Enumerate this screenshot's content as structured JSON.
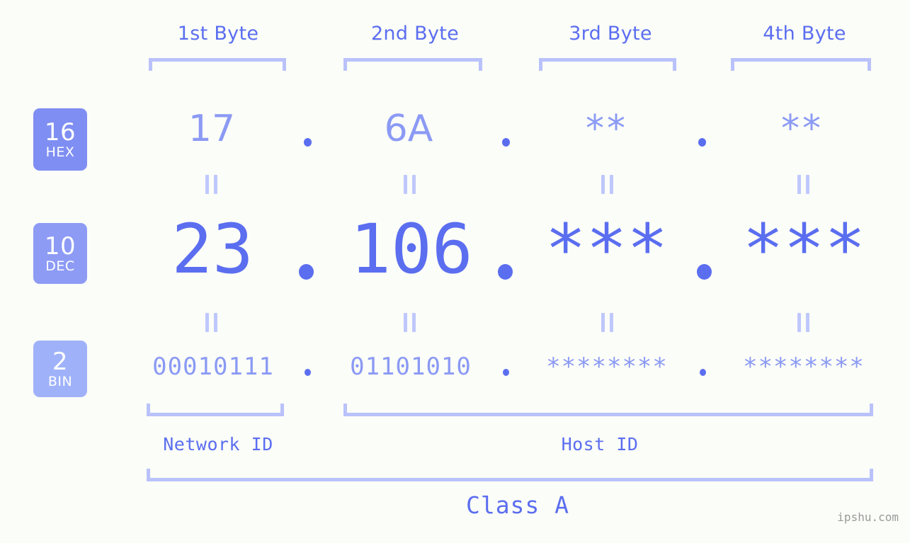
{
  "meta": {
    "background": "#fbfdf8",
    "accent": "#5b6ef0",
    "accent_light": "#8b9af4",
    "accent_pale": "#b9c2fb"
  },
  "header": {
    "byte_labels": [
      "1st Byte",
      "2nd Byte",
      "3rd Byte",
      "4th Byte"
    ]
  },
  "bases": [
    {
      "number": "16",
      "name": "HEX",
      "color": "#7e8ef2"
    },
    {
      "number": "10",
      "name": "DEC",
      "color": "#8d9bf5"
    },
    {
      "number": "2",
      "name": "BIN",
      "color": "#9fb2f9"
    }
  ],
  "rows": {
    "hex": {
      "base": "16",
      "label": "HEX",
      "values": [
        "17",
        "6A",
        "**",
        "**"
      ]
    },
    "dec": {
      "base": "10",
      "label": "DEC",
      "values": [
        "23",
        "106",
        "***",
        "***"
      ]
    },
    "bin": {
      "base": "2",
      "label": "BIN",
      "values": [
        "00010111",
        "01101010",
        "********",
        "********"
      ]
    }
  },
  "separators": {
    "dot": ".",
    "equals": "="
  },
  "footer": {
    "network_id": "Network ID",
    "host_id": "Host ID",
    "class": "Class A",
    "watermark": "ipshu.com"
  }
}
